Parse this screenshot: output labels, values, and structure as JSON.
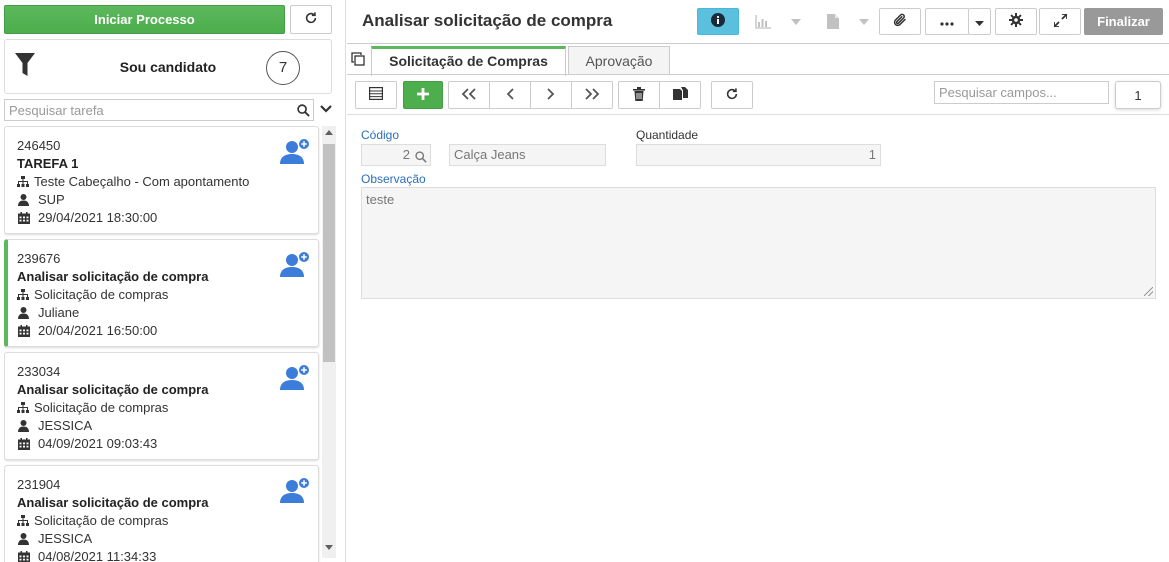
{
  "left": {
    "start_process_label": "Iniciar Processo",
    "candidate_title": "Sou candidato",
    "candidate_count": "7",
    "search_placeholder": "Pesquisar tarefa",
    "tasks": [
      {
        "id": "246450",
        "title": "TAREFA 1",
        "process": "Teste Cabeçalho - Com apontamento",
        "user": "SUP",
        "date": "29/04/2021 18:30:00"
      },
      {
        "id": "239676",
        "title": "Analisar solicitação de compra",
        "process": "Solicitação de compras",
        "user": "Juliane",
        "date": "20/04/2021 16:50:00"
      },
      {
        "id": "233034",
        "title": "Analisar solicitação de compra",
        "process": "Solicitação de compras",
        "user": "JESSICA",
        "date": "04/09/2021 09:03:43"
      },
      {
        "id": "231904",
        "title": "Analisar solicitação de compra",
        "process": "Solicitação de compras",
        "user": "JESSICA",
        "date": "04/08/2021 11:34:33"
      }
    ]
  },
  "header": {
    "title": "Analisar solicitação de compra",
    "finalize_label": "Finalizar"
  },
  "tabs": [
    {
      "label": "Solicitação de Compras"
    },
    {
      "label": "Aprovação"
    }
  ],
  "toolbar": {
    "search_fields_placeholder": "Pesquisar campos...",
    "page_number": "1"
  },
  "form": {
    "codigo_label": "Código",
    "codigo_value": "2",
    "produto_value": "Calça Jeans",
    "quantidade_label": "Quantidade",
    "quantidade_value": "1",
    "observacao_label": "Observação",
    "observacao_value": "teste"
  },
  "colors": {
    "accent_green": "#5cb85c",
    "info_blue": "#5bc0de",
    "add_user_blue": "#3b7dd8",
    "label_blue": "#2a6ebb"
  }
}
